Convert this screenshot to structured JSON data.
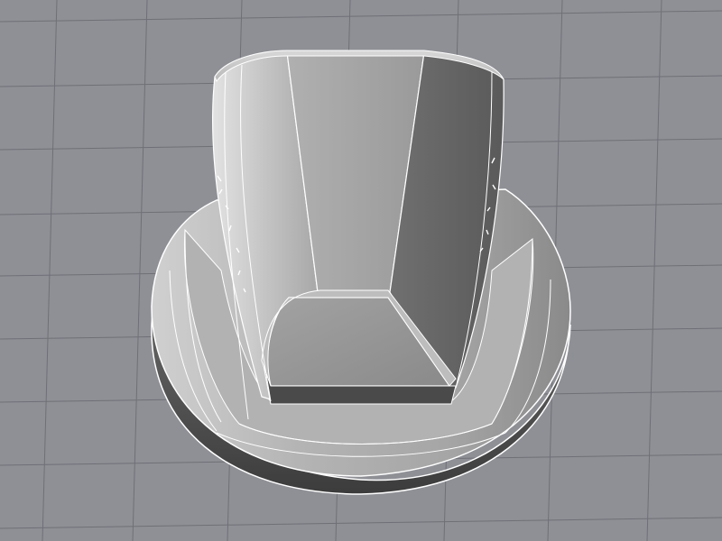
{
  "viewport": {
    "background_color": "#8f9096",
    "grid_line_color": "#6f7077",
    "grid": true
  },
  "model": {
    "name": "",
    "display_mode": "shaded-with-wireframe",
    "surface_colors": {
      "light": "#c8c8c8",
      "mid": "#9c9c9c",
      "dark": "#5e5e5e",
      "darkest": "#3a3a3a"
    },
    "edge_color": "#ffffff"
  }
}
